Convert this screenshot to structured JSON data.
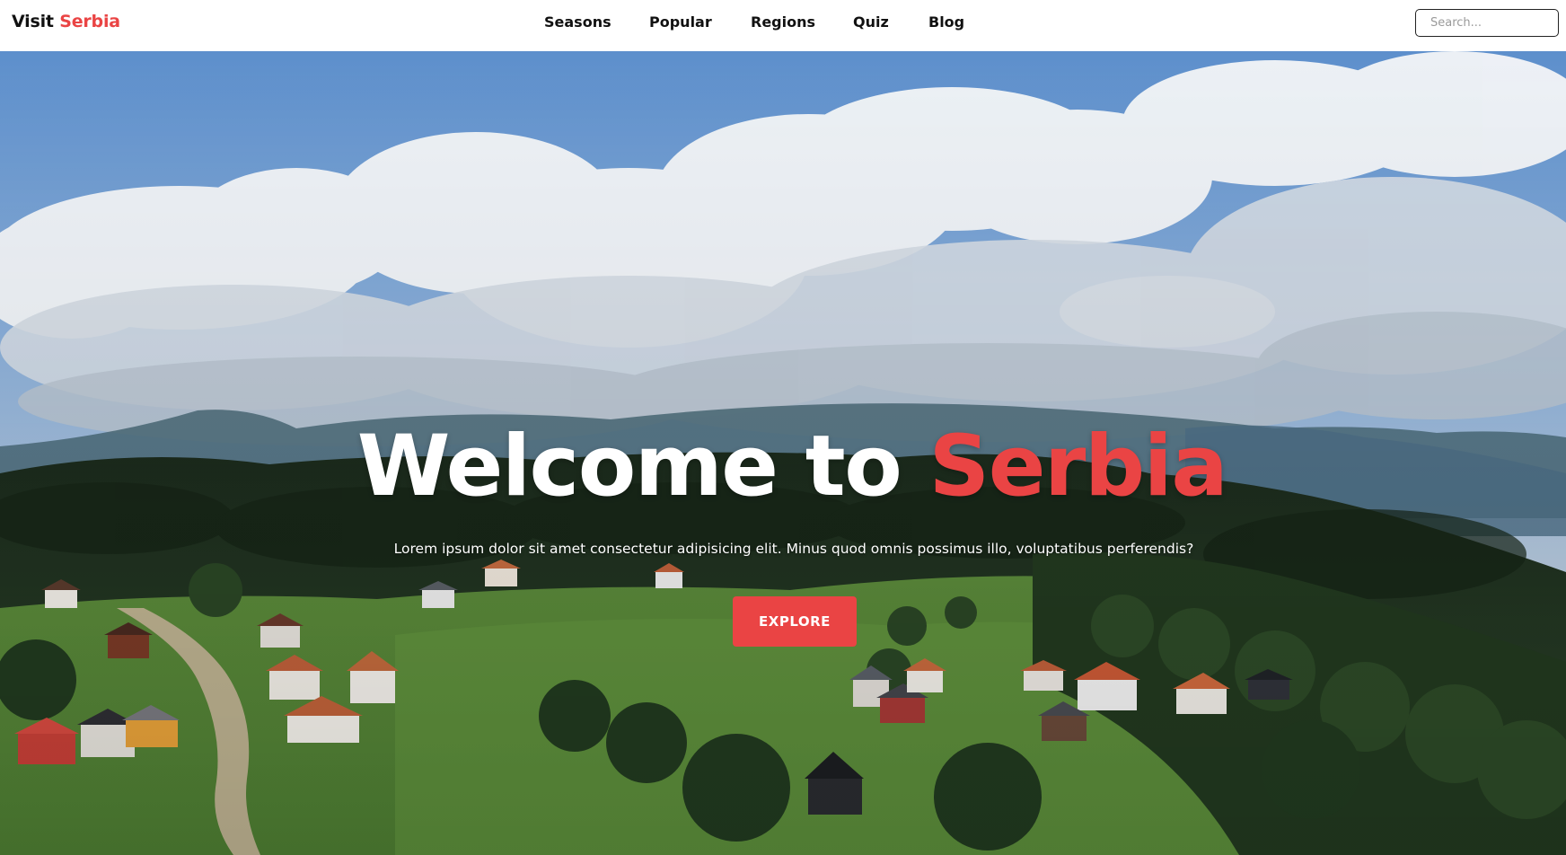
{
  "brand": {
    "prefix": "Visit",
    "name": "Serbia",
    "accent_color": "#ea4444"
  },
  "nav": {
    "links": [
      {
        "label": "Seasons"
      },
      {
        "label": "Popular"
      },
      {
        "label": "Regions"
      },
      {
        "label": "Quiz"
      },
      {
        "label": "Blog"
      }
    ]
  },
  "search": {
    "placeholder": "Search...",
    "value": ""
  },
  "hero": {
    "title_prefix": "Welcome to",
    "title_accent": "Serbia",
    "subtitle": "Lorem ipsum dolor sit amet consectetur adipisicing elit. Minus quod omnis possimus illo, voluptatibus perferendis?",
    "cta_label": "EXPLORE",
    "background": "aerial photo of mountain village with clouds"
  }
}
